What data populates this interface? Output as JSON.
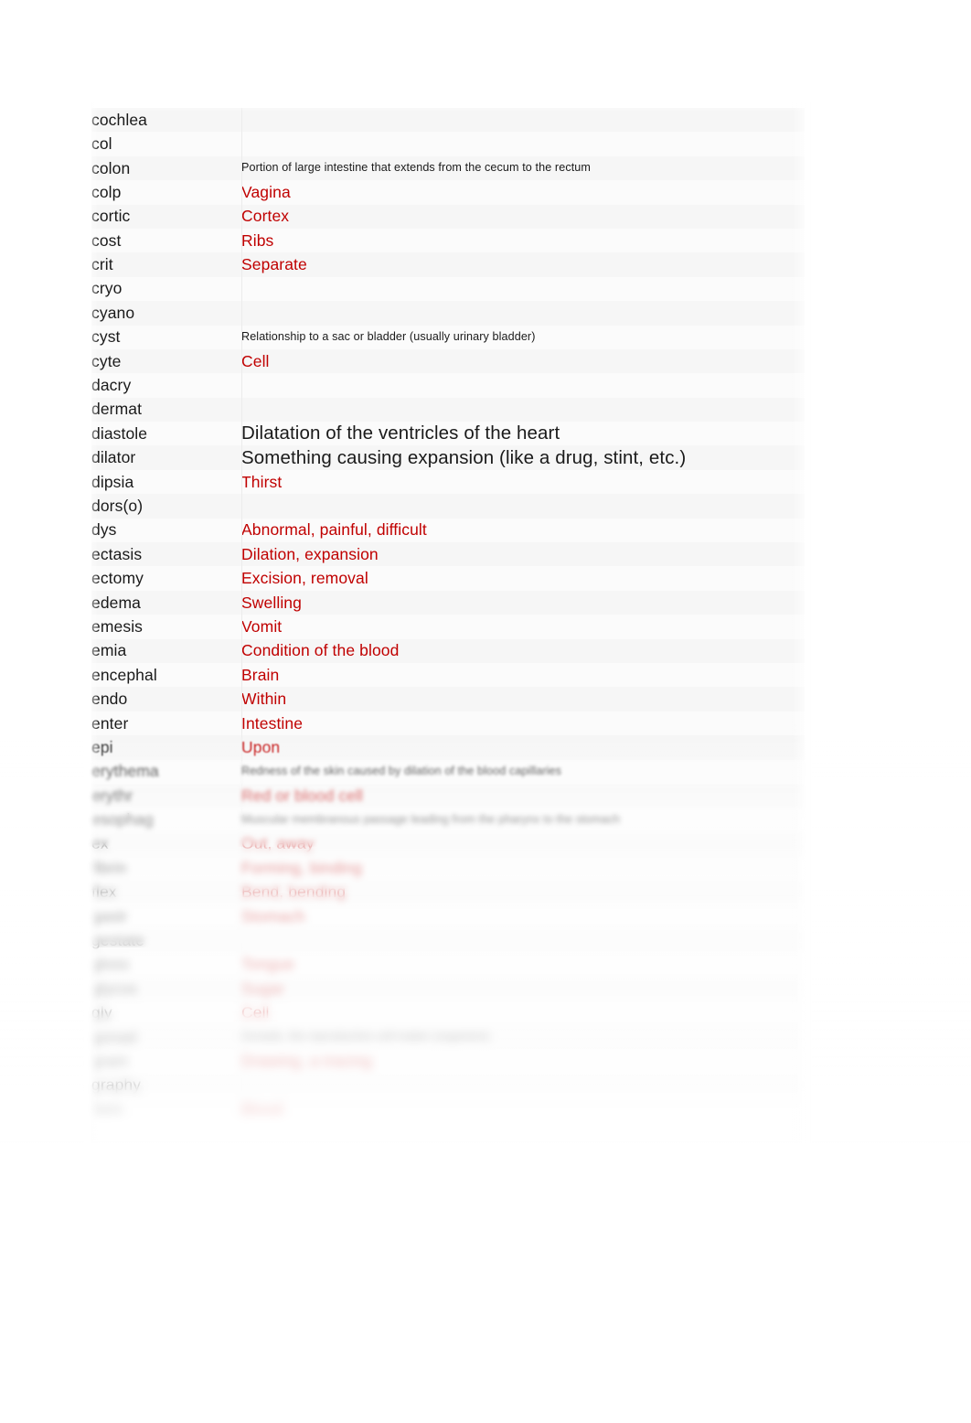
{
  "document": {
    "type": "glossary-table",
    "accent_color": "#C00000",
    "text_color": "#1a1a1a",
    "row_stripe_colors": [
      "#f6f6f6",
      "#fbfbfb"
    ],
    "columns": [
      "term",
      "definition"
    ]
  },
  "rows": [
    {
      "term": "cochlea",
      "definition": "",
      "style": "red"
    },
    {
      "term": "col",
      "definition": "",
      "style": "red"
    },
    {
      "term": "colon",
      "definition": "Portion of large intestine that extends from the cecum to the rectum",
      "style": "small-black"
    },
    {
      "term": "colp",
      "definition": "Vagina",
      "style": "red"
    },
    {
      "term": "cortic",
      "definition": "Cortex",
      "style": "red"
    },
    {
      "term": "cost",
      "definition": "Ribs",
      "style": "red"
    },
    {
      "term": "crit",
      "definition": "Separate",
      "style": "red"
    },
    {
      "term": "cryo",
      "definition": "",
      "style": "red"
    },
    {
      "term": "cyano",
      "definition": "",
      "style": "red"
    },
    {
      "term": "cyst",
      "definition": "Relationship to a sac or bladder (usually urinary bladder)",
      "style": "small-black"
    },
    {
      "term": "cyte",
      "definition": "Cell",
      "style": "red"
    },
    {
      "term": "dacry",
      "definition": "",
      "style": "red"
    },
    {
      "term": "dermat",
      "definition": "",
      "style": "red"
    },
    {
      "term": "diastole",
      "definition": "Dilatation of the ventricles of the heart",
      "style": "large-black"
    },
    {
      "term": "dilator",
      "definition": "Something causing expansion (like a drug, stint, etc.)",
      "style": "large-black"
    },
    {
      "term": "dipsia",
      "definition": "Thirst",
      "style": "red"
    },
    {
      "term": "dors(o)",
      "definition": "",
      "style": "red"
    },
    {
      "term": "dys",
      "definition": "Abnormal, painful, difficult",
      "style": "red"
    },
    {
      "term": "ectasis",
      "definition": "Dilation, expansion",
      "style": "red"
    },
    {
      "term": "ectomy",
      "definition": "Excision, removal",
      "style": "red"
    },
    {
      "term": "edema",
      "definition": "Swelling",
      "style": "red"
    },
    {
      "term": "emesis",
      "definition": "Vomit",
      "style": "red"
    },
    {
      "term": "emia",
      "definition": "Condition of the blood",
      "style": "red"
    },
    {
      "term": "encephal",
      "definition": "Brain",
      "style": "red"
    },
    {
      "term": "endo",
      "definition": "Within",
      "style": "red"
    },
    {
      "term": "enter",
      "definition": "Intestine",
      "style": "red"
    },
    {
      "term": "epi",
      "definition": "Upon",
      "style": "red"
    },
    {
      "term": "erythema",
      "definition": "Redness of the skin caused by dilation of the blood capillaries",
      "style": "small-black"
    },
    {
      "term": "erythr",
      "definition": "Red or blood cell",
      "style": "red"
    },
    {
      "term": "esophag",
      "definition": "Muscular membranous passage leading from the pharynx to the stomach",
      "style": "small-black"
    },
    {
      "term": "ex",
      "definition": "Out, away",
      "style": "red"
    },
    {
      "term": "fibrin",
      "definition": "Forming, binding",
      "style": "red"
    },
    {
      "term": "flex",
      "definition": "Bend, bending",
      "style": "red"
    },
    {
      "term": "gastr",
      "definition": "Stomach",
      "style": "red"
    },
    {
      "term": "gestate",
      "definition": "",
      "style": "red"
    },
    {
      "term": "gloss",
      "definition": "Tongue",
      "style": "red"
    },
    {
      "term": "glycos",
      "definition": "Sugar",
      "style": "red"
    },
    {
      "term": "gly",
      "definition": "Cell",
      "style": "red"
    },
    {
      "term": "gonad",
      "definition": "Gonads, the reproductive cell-maker (organism)",
      "style": "small-black"
    },
    {
      "term": "gram",
      "definition": "Drawing, a tracing",
      "style": "red"
    },
    {
      "term": "graphy",
      "definition": "",
      "style": "red"
    },
    {
      "term": "hem",
      "definition": "Blood",
      "style": "red"
    }
  ]
}
